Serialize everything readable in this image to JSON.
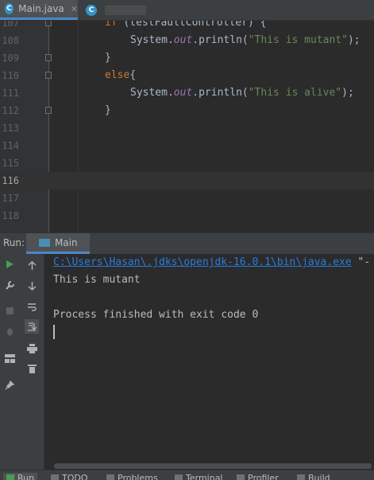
{
  "tabs": [
    {
      "label": "Main.java",
      "active": true
    },
    {
      "label": "",
      "active": false
    }
  ],
  "editor": {
    "lines": [
      {
        "n": "107"
      },
      {
        "n": "108"
      },
      {
        "n": "109"
      },
      {
        "n": "110"
      },
      {
        "n": "111"
      },
      {
        "n": "112"
      },
      {
        "n": "113"
      },
      {
        "n": "114"
      },
      {
        "n": "115"
      },
      {
        "n": "116"
      },
      {
        "n": "117"
      },
      {
        "n": "118"
      }
    ],
    "code": {
      "l107_kw": "if",
      "l107_rest": " (testFaultController) {",
      "sys": "System.",
      "out": "out",
      "println": ".println(",
      "l108_str": "\"This is mutant\"",
      "close": ");",
      "brace": "}",
      "else_kw": "else",
      "else_brace": "{",
      "l111_str": "\"This is alive\""
    }
  },
  "run": {
    "label": "Run:",
    "tab": "Main",
    "console": {
      "cmd_path": "C:\\Users\\Hasan\\.jdks\\openjdk-16.0.1\\bin\\java.exe",
      "cmd_rest": " \"-",
      "out1": "This is mutant",
      "out2": "Process finished with exit code 0"
    }
  },
  "statusbar": {
    "items": [
      "Run",
      "TODO",
      "Problems",
      "Terminal",
      "Profiler",
      "Build"
    ]
  },
  "colors": {
    "accent": "#4a88c7",
    "keyword": "#cc7832",
    "string": "#6a8759",
    "static_field": "#9876aa",
    "link": "#287bde",
    "run_green": "#499c54"
  }
}
